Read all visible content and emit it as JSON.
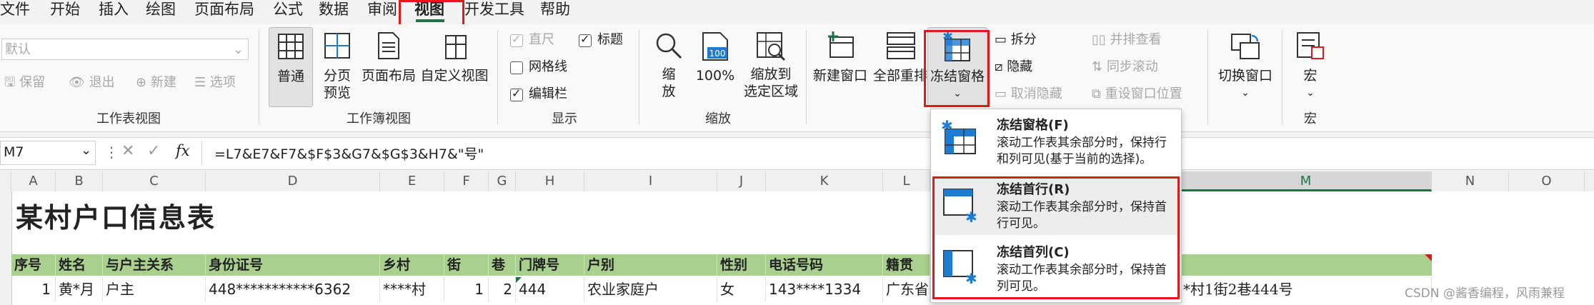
{
  "menu": {
    "items": [
      "文件",
      "开始",
      "插入",
      "绘图",
      "页面布局",
      "公式",
      "数据",
      "审阅",
      "视图",
      "开发工具",
      "帮助"
    ],
    "active": "视图"
  },
  "ribbon": {
    "workbook_views_partial": {
      "style_select": "默认",
      "keep": "保留",
      "exit": "退出",
      "new": "新建",
      "options": "选项",
      "group_label": "工作表视图"
    },
    "workbook_view": {
      "normal": "普通",
      "page_break": "分页\n预览",
      "page_layout": "页面布局",
      "custom": "自定义视图",
      "group_label": "工作簿视图"
    },
    "show": {
      "ruler": "直尺",
      "title": "标题",
      "gridlines": "网格线",
      "formula_bar": "编辑栏",
      "group_label": "显示"
    },
    "zoom": {
      "zoom": "缩\n放",
      "hundred": "100%",
      "zoom_to_selection": "缩放到\n选定区域",
      "group_label": "缩放",
      "hundred_icon_text": "100"
    },
    "window": {
      "new_window": "新建窗口",
      "arrange_all": "全部重排",
      "freeze_panes": "冻结窗格",
      "split": "拆分",
      "hide": "隐藏",
      "unhide": "取消隐藏",
      "side_by_side": "并排查看",
      "sync_scroll": "同步滚动",
      "reset_position": "重设窗口位置",
      "switch_windows": "切换窗口"
    },
    "macros": {
      "macros": "宏",
      "group_label": "宏"
    }
  },
  "formula_bar": {
    "name_box": "M7",
    "fx": "fx",
    "formula": "=L7&E7&F7&$F$3&G7&$G$3&H7&\"号\""
  },
  "columns": [
    "A",
    "B",
    "C",
    "D",
    "E",
    "F",
    "G",
    "H",
    "I",
    "J",
    "K",
    "L",
    "M",
    "N",
    "O"
  ],
  "sheet": {
    "title": "某村户口信息表",
    "headers": [
      "序号",
      "姓名",
      "与户主关系",
      "身份证号",
      "乡村",
      "街",
      "巷",
      "门牌号",
      "户别",
      "性别",
      "电话号码",
      "籍贯"
    ],
    "row": [
      "1",
      "黄*月",
      "户主",
      "448***********6362",
      "****村",
      "1",
      "2",
      "444",
      "农业家庭户",
      "女",
      "143****1334",
      "广东省"
    ],
    "m_value": "*村1街2巷444号"
  },
  "dropdown": {
    "items": [
      {
        "title": "冻结窗格(F)",
        "desc": "滚动工作表其余部分时，保持行和列可见(基于当前的选择)。"
      },
      {
        "title": "冻结首行(R)",
        "desc": "滚动工作表其余部分时，保持首行可见。"
      },
      {
        "title": "冻结首列(C)",
        "desc": "滚动工作表其余部分时，保持首列可见。"
      }
    ]
  },
  "watermark": "CSDN @酱香编程，风雨兼程",
  "colors": {
    "accent": "#217346",
    "highlight_red": "#e0191d",
    "header_green": "#a9d08e",
    "icon_blue": "#1e7bd2"
  }
}
